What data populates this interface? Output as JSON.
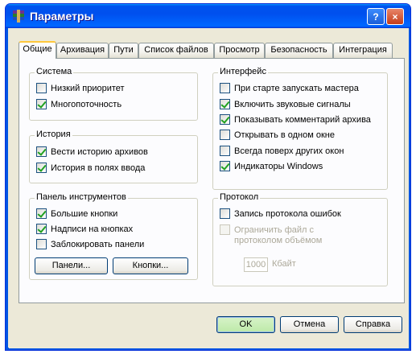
{
  "window": {
    "title": "Параметры",
    "help_label": "?",
    "close_label": "×"
  },
  "tabs": [
    "Общие",
    "Архивация",
    "Пути",
    "Список файлов",
    "Просмотр",
    "Безопасность",
    "Интеграция"
  ],
  "groups": {
    "system": {
      "legend": "Система",
      "options": [
        {
          "label": "Низкий приоритет",
          "checked": false
        },
        {
          "label": "Многопоточность",
          "checked": true
        }
      ]
    },
    "history": {
      "legend": "История",
      "options": [
        {
          "label": "Вести историю архивов",
          "checked": true
        },
        {
          "label": "История в полях ввода",
          "checked": true
        }
      ]
    },
    "toolbar": {
      "legend": "Панель инструментов",
      "options": [
        {
          "label": "Большие кнопки",
          "checked": true
        },
        {
          "label": "Надписи на кнопках",
          "checked": true
        },
        {
          "label": "Заблокировать панели",
          "checked": false
        }
      ],
      "panels_button": "Панели...",
      "buttons_button": "Кнопки..."
    },
    "interface": {
      "legend": "Интерфейс",
      "options": [
        {
          "label": "При старте запускать мастера",
          "checked": false
        },
        {
          "label": "Включить звуковые сигналы",
          "checked": true
        },
        {
          "label": "Показывать комментарий архива",
          "checked": true
        },
        {
          "label": "Открывать в одном окне",
          "checked": false
        },
        {
          "label": "Всегда поверх других окон",
          "checked": false
        },
        {
          "label": "Индикаторы Windows",
          "checked": true
        }
      ]
    },
    "protocol": {
      "legend": "Протокол",
      "log_errors": {
        "label": "Запись протокола ошибок",
        "checked": false
      },
      "limit_file": {
        "label_line1": "Ограничить файл с",
        "label_line2": "протоколом объёмом",
        "checked": false,
        "disabled": true
      },
      "size_value": "1000",
      "size_unit": "Кбайт"
    }
  },
  "footer": {
    "ok": "OK",
    "cancel": "Отмена",
    "help": "Справка"
  }
}
